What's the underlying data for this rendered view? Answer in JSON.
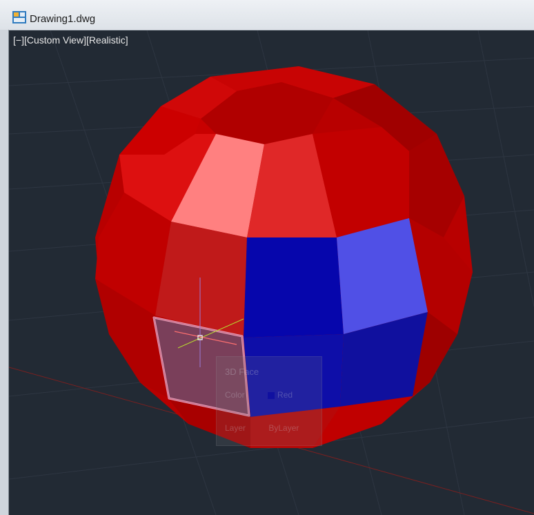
{
  "window": {
    "title": "Drawing1.dwg"
  },
  "viewport": {
    "controls_label": "[−]",
    "view_label": "[Custom View]",
    "style_label": "[Realistic]"
  },
  "tooltip": {
    "title": "3D Face",
    "color_label": "Color",
    "color_value": "Red",
    "layer_label": "Layer",
    "layer_value": "ByLayer"
  },
  "colors": {
    "background": "#222a34",
    "sphere_red": "#c40000",
    "highlight_blue": "#0a0aaa",
    "selected_face": "#7a3f5a"
  }
}
